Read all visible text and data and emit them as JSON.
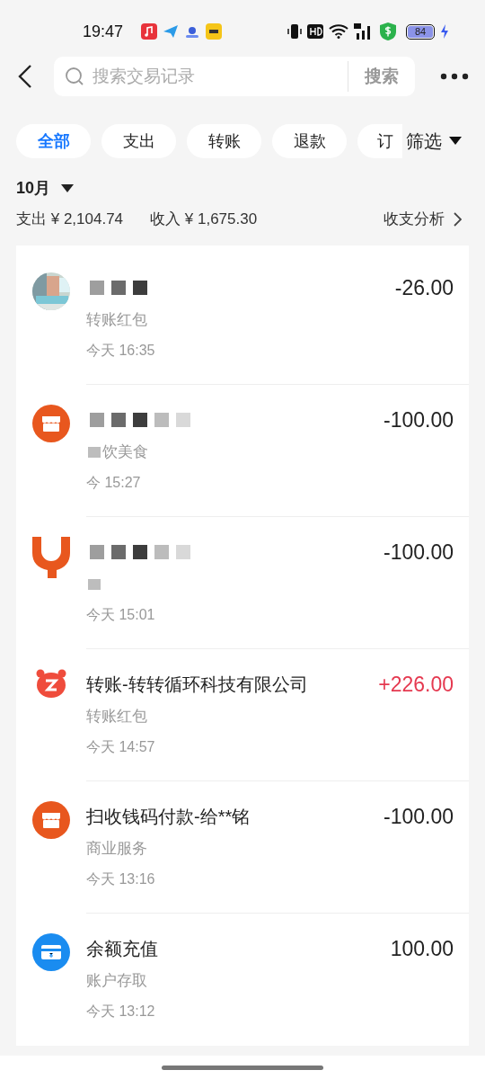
{
  "status_bar": {
    "time": "19:47",
    "battery": "84"
  },
  "search": {
    "placeholder": "搜索交易记录",
    "button": "搜索"
  },
  "filters": [
    {
      "label": "全部",
      "selected": true
    },
    {
      "label": "支出",
      "selected": false
    },
    {
      "label": "转账",
      "selected": false
    },
    {
      "label": "退款",
      "selected": false
    },
    {
      "label": "订",
      "selected": false
    }
  ],
  "filter_menu": "筛选",
  "month": "10月",
  "summary": {
    "expense": "支出 ¥ 2,104.74",
    "income": "收入 ¥ 1,675.30",
    "analysis": "收支分析"
  },
  "transactions": [
    {
      "title_redacted": true,
      "amount": "-26.00",
      "income": false,
      "category": "转账红包",
      "time": "今天 16:35"
    },
    {
      "kind": "shop",
      "title_redacted": true,
      "amount": "-100.00",
      "income": false,
      "category": "饮美食",
      "category_redacted": true,
      "time": "今 15:27"
    },
    {
      "kind": "cup",
      "title_redacted": true,
      "amount": "-100.00",
      "income": false,
      "category_redacted": true,
      "time": "今天 15:01"
    },
    {
      "kind": "bear",
      "title": "转账-转转循环科技有限公司",
      "amount": "+226.00",
      "income": true,
      "category": "转账红包",
      "time": "今天 14:57"
    },
    {
      "kind": "shop",
      "title": "扫收钱码付款-给**铭",
      "amount": "-100.00",
      "income": false,
      "category": "商业服务",
      "time": "今天 13:16"
    },
    {
      "kind": "card",
      "title": "余额充值",
      "amount": "100.00",
      "income": false,
      "category": "账户存取",
      "time": "今天 13:12"
    }
  ]
}
